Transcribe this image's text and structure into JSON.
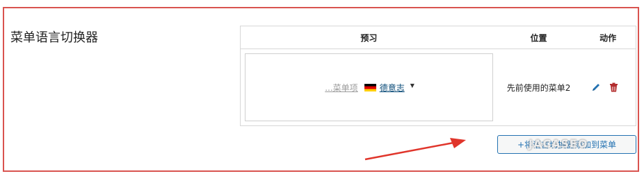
{
  "section": {
    "title": "菜单语言切换器"
  },
  "table": {
    "headers": {
      "preview": "预习",
      "location": "位置",
      "actions": "动作"
    },
    "rows": [
      {
        "preview": {
          "ellipsis_item": "...菜单项",
          "language": "德意志",
          "flag": "german-flag-icon"
        },
        "location": "先前使用的菜单2"
      }
    ]
  },
  "add_button": {
    "label": "+将语言切换器添加到菜单"
  },
  "watermark": {
    "text": "JACASEO"
  },
  "colors": {
    "frame_border": "#d9534f",
    "link": "#0a4b78",
    "edit_icon": "#2271b1",
    "delete_icon": "#b32d2e",
    "arrow": "#e0352b"
  }
}
